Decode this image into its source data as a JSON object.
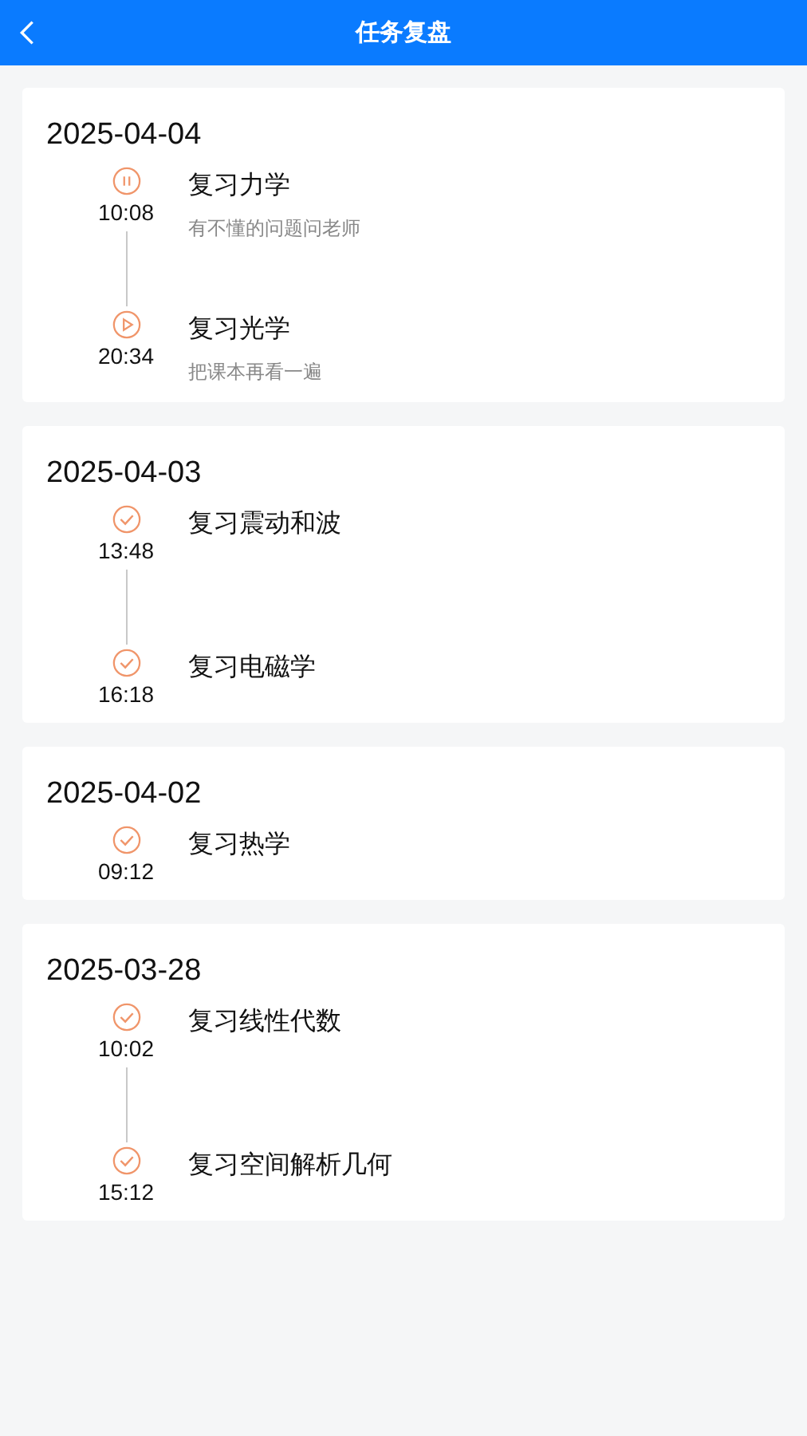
{
  "header": {
    "title": "任务复盘"
  },
  "days": [
    {
      "date": "2025-04-04",
      "tasks": [
        {
          "kind": "paused",
          "time": "10:08",
          "title": "复习力学",
          "note": "有不懂的问题问老师"
        },
        {
          "kind": "playing",
          "time": "20:34",
          "title": "复习光学",
          "note": "把课本再看一遍"
        }
      ]
    },
    {
      "date": "2025-04-03",
      "tasks": [
        {
          "kind": "done",
          "time": "13:48",
          "title": "复习震动和波"
        },
        {
          "kind": "done",
          "time": "16:18",
          "title": "复习电磁学"
        }
      ]
    },
    {
      "date": "2025-04-02",
      "tasks": [
        {
          "kind": "done",
          "time": "09:12",
          "title": "复习热学"
        }
      ]
    },
    {
      "date": "2025-03-28",
      "tasks": [
        {
          "kind": "done",
          "time": "10:02",
          "title": "复习线性代数"
        },
        {
          "kind": "done",
          "time": "15:12",
          "title": "复习空间解析几何"
        }
      ]
    }
  ]
}
